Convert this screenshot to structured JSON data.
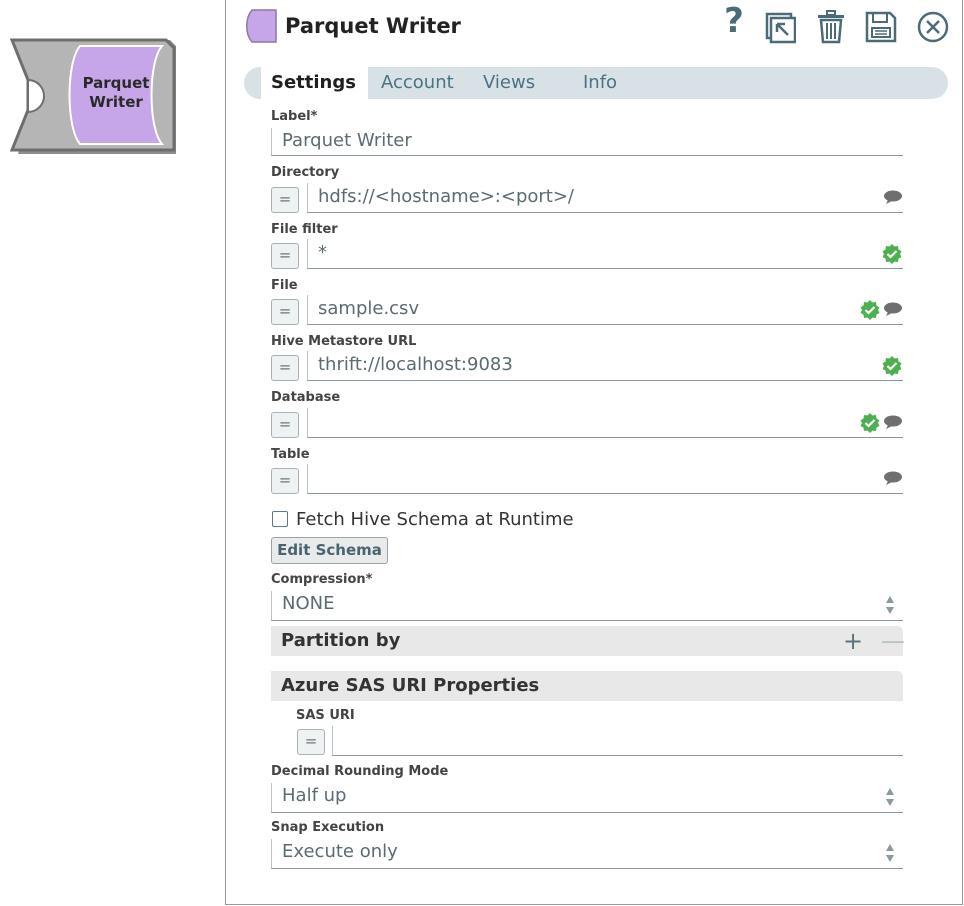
{
  "canvas_snap": {
    "label_line1": "Parquet",
    "label_line2": "Writer"
  },
  "dialog": {
    "title": "Parquet Writer",
    "toolbar": {
      "help_icon": "?"
    },
    "tabs": [
      "Settings",
      "Account",
      "Views",
      "Info"
    ],
    "fields": {
      "label": {
        "label": "Label*",
        "value": "Parquet Writer"
      },
      "directory": {
        "label": "Directory",
        "value": "hdfs://<hostname>:<port>/",
        "expr": "="
      },
      "file_filter": {
        "label": "File filter",
        "value": "*",
        "expr": "="
      },
      "file": {
        "label": "File",
        "value": "sample.csv",
        "expr": "="
      },
      "hive_metastore_url": {
        "label": "Hive Metastore URL",
        "value": "thrift://localhost:9083",
        "expr": "="
      },
      "database": {
        "label": "Database",
        "value": "",
        "expr": "="
      },
      "table": {
        "label": "Table",
        "value": "",
        "expr": "="
      },
      "fetch_hive_schema": {
        "label": "Fetch Hive Schema at Runtime",
        "checked": false
      },
      "edit_schema": {
        "label": "Edit Schema"
      },
      "compression": {
        "label": "Compression*",
        "value": "NONE"
      },
      "partition_by": {
        "title": "Partition by",
        "add": "+",
        "remove": "—"
      },
      "azure_sas": {
        "title": "Azure SAS URI Properties",
        "sas_uri_label": "SAS URI",
        "sas_uri_value": "",
        "expr": "="
      },
      "decimal_rounding_mode": {
        "label": "Decimal Rounding Mode",
        "value": "Half up"
      },
      "snap_execution": {
        "label": "Snap Execution",
        "value": "Execute only"
      }
    }
  },
  "colors": {
    "snap_purple": "#c6a5e8",
    "valid_green": "#4caf50",
    "tab_bar": "#d8e2e6",
    "icon_slate": "#4c6b78"
  }
}
